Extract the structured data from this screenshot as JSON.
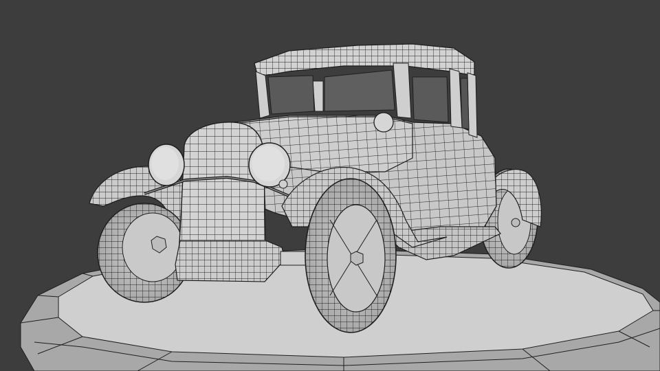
{
  "scene": {
    "subject": "wireframe-vintage-coupe",
    "colors": {
      "background": "#3d3d3d",
      "surface": "#c9c9c9",
      "surface_light": "#d9d9d9",
      "surface_shade": "#a9a9a9",
      "wire": "#1e1e1e",
      "window": "#5a5a5a"
    }
  }
}
